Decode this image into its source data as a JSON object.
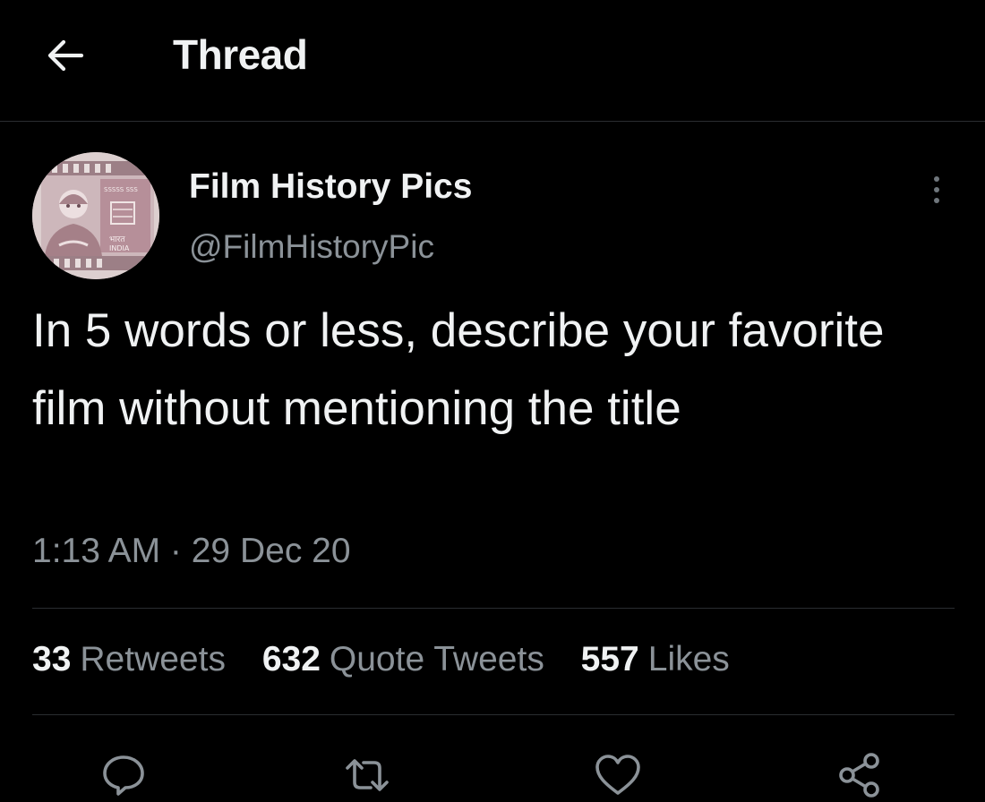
{
  "header": {
    "title": "Thread",
    "back_icon": "arrow-left-icon"
  },
  "tweet": {
    "author": {
      "display_name": "Film History Pics",
      "handle": "@FilmHistoryPic",
      "avatar_text_top": "भारत",
      "avatar_text_bottom": "INDIA"
    },
    "text": "In 5 words or less, describe your favorite film without mentioning the title",
    "timestamp": "1:13 AM · 29 Dec 20",
    "stats": {
      "retweets_count": "33",
      "retweets_label": "Retweets",
      "quotes_count": "632",
      "quotes_label": "Quote Tweets",
      "likes_count": "557",
      "likes_label": "Likes"
    },
    "actions": [
      "reply-icon",
      "retweet-icon",
      "like-icon",
      "share-icon"
    ]
  },
  "colors": {
    "background": "#000000",
    "text_primary": "#f0f2f3",
    "text_secondary": "#8b9298",
    "divider": "#2a2d30"
  }
}
